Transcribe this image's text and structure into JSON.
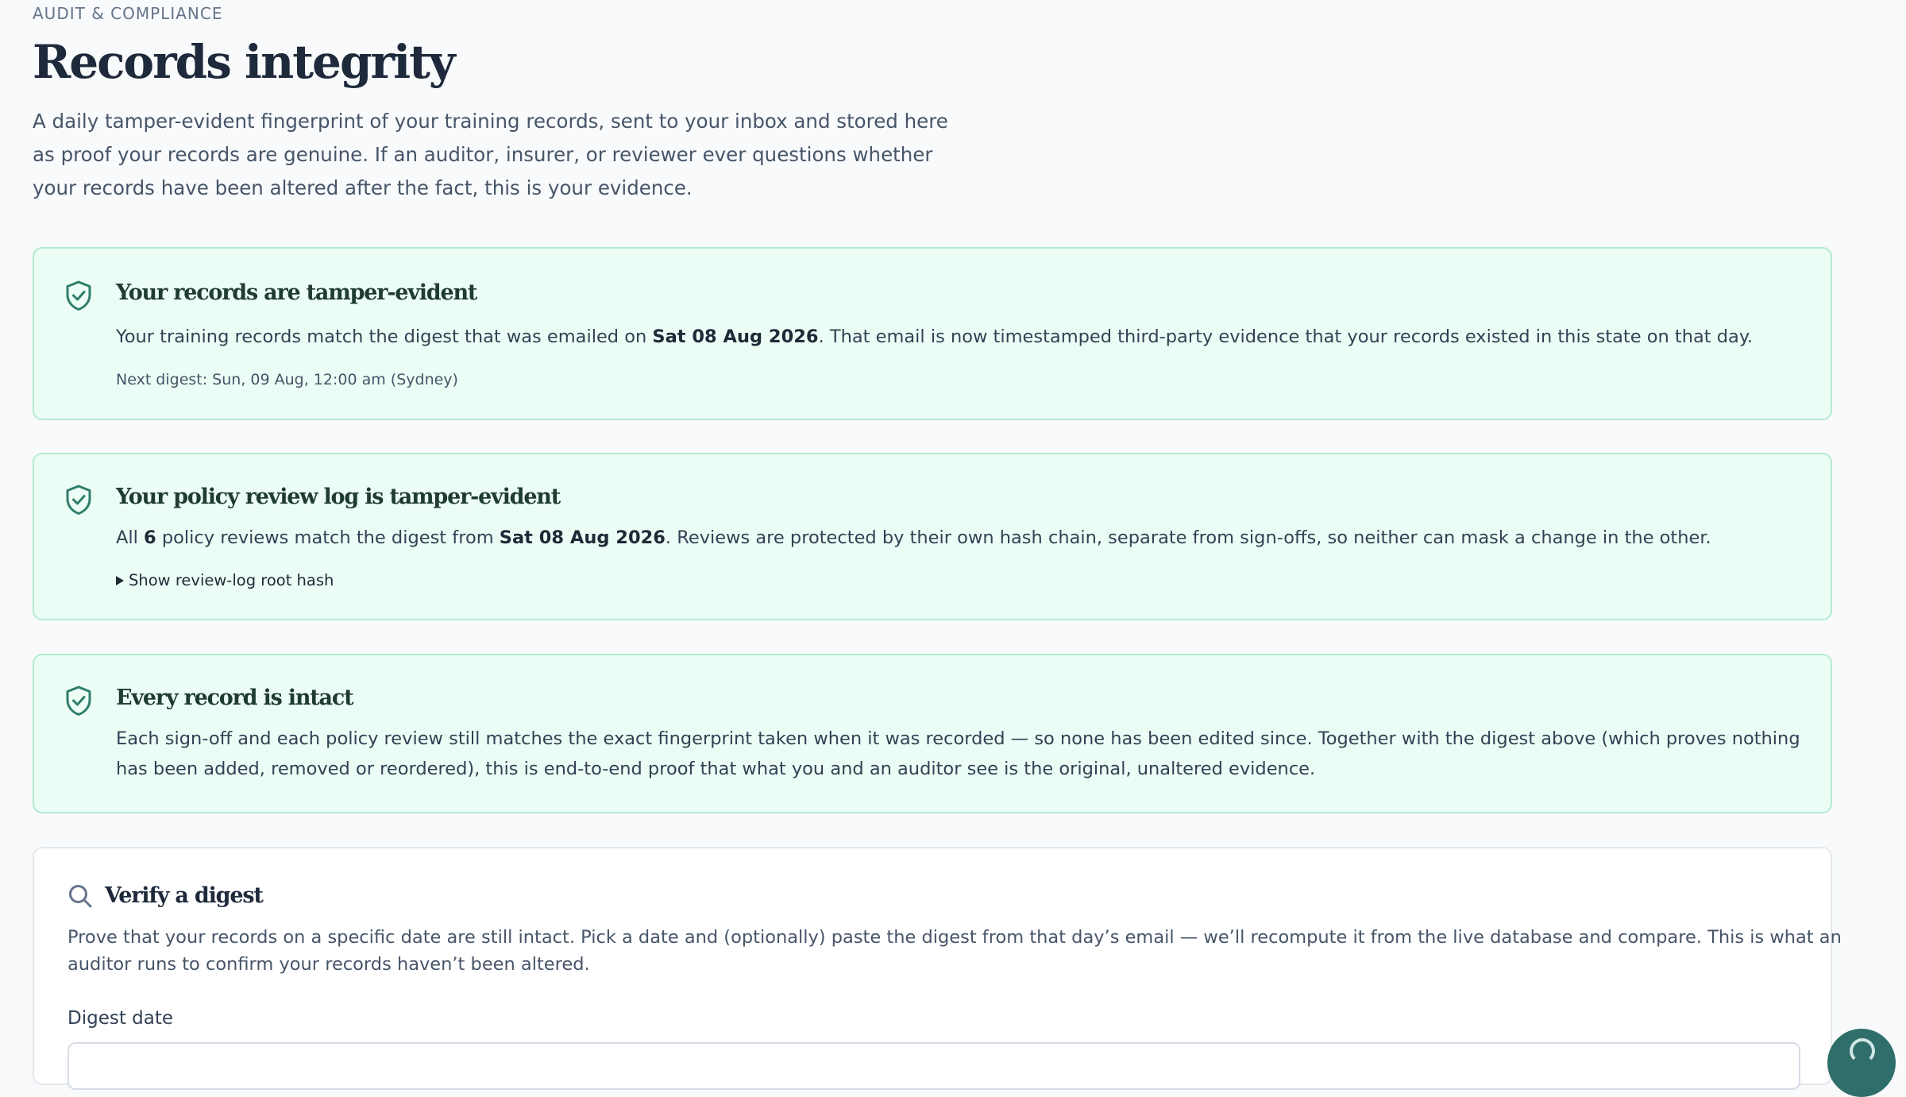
{
  "header": {
    "eyebrow": "AUDIT & COMPLIANCE",
    "title": "Records integrity",
    "intro": "A daily tamper-evident fingerprint of your training records, sent to your inbox and stored here as proof your records are genuine. If an auditor, insurer, or reviewer ever questions whether your records have been altered after the fact, this is your evidence."
  },
  "cards": {
    "records": {
      "icon": "shield-check-icon",
      "title": "Your records are tamper-evident",
      "body_before": "Your training records match the digest that was emailed on ",
      "body_date": "Sat 08 Aug 2026",
      "body_after": ". That email is now timestamped third-party evidence that your records existed in this state on that day.",
      "next_digest": "Next digest: Sun, 09 Aug, 12:00 am (Sydney)"
    },
    "policy_log": {
      "icon": "shield-check-icon",
      "title": "Your policy review log is tamper-evident",
      "body_prefix": "All ",
      "review_count": "6",
      "body_middle": " policy reviews match the digest from ",
      "body_date": "Sat 08 Aug 2026",
      "body_after": ". Reviews are protected by their own hash chain, separate from sign-offs, so neither can mask a change in the other.",
      "toggle_label": "Show review-log root hash"
    },
    "intact": {
      "icon": "shield-check-icon",
      "title": "Every record is intact",
      "body": "Each sign-off and each policy review still matches the exact fingerprint taken when it was recorded — so none has been edited since. Together with the digest above (which proves nothing has been added, removed or reordered), this is end-to-end proof that what you and an auditor see is the original, unaltered evidence."
    }
  },
  "verify": {
    "icon": "search-icon",
    "title": "Verify a digest",
    "description": "Prove that your records on a specific date are still intact. Pick a date and (optionally) paste the digest from that day’s email — we’ll recompute it from the live database and compare. This is what an auditor runs to confirm your records haven’t been altered.",
    "date_label": "Digest date",
    "date_value": ""
  },
  "colors": {
    "accent": "#2f7d6d",
    "success_bg": "#ecfdf5",
    "success_border": "#b5ead1",
    "help_button": "#2f6e6a"
  },
  "help_button": {
    "icon": "help-chat-icon"
  }
}
